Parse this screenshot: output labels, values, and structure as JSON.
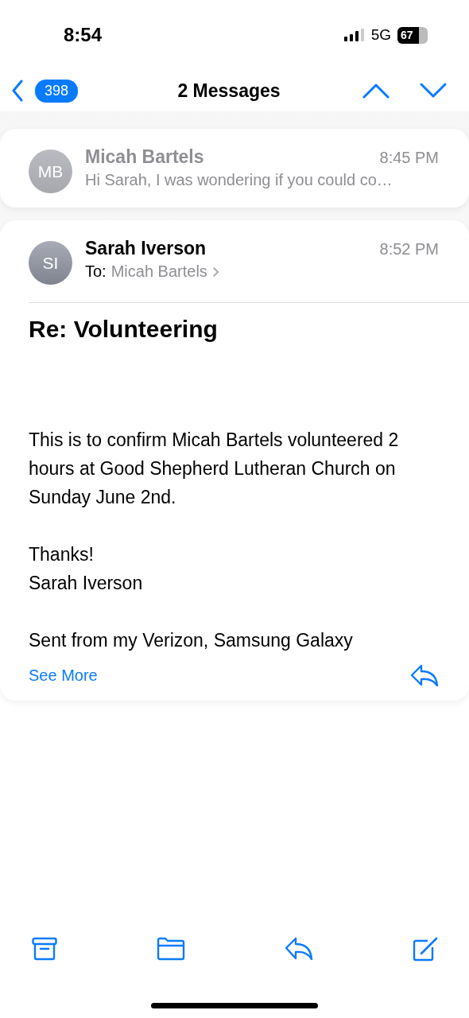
{
  "status_bar": {
    "time": "8:54",
    "network": "5G",
    "battery": "67"
  },
  "nav": {
    "back_count": "398",
    "title": "2 Messages"
  },
  "messages": [
    {
      "initials": "MB",
      "sender": "Micah Bartels",
      "time": "8:45 PM",
      "expanded": false,
      "preview": "Hi Sarah, I was wondering if you could co…"
    },
    {
      "initials": "SI",
      "sender": "Sarah Iverson",
      "time": "8:52 PM",
      "expanded": true,
      "to_label": "To:",
      "to": "Micah Bartels",
      "subject": "Re: Volunteering",
      "body": [
        "This is to confirm Micah Bartels volunteered 2 hours at Good Shepherd Lutheran Church on Sunday June 2nd.",
        "Thanks!\nSarah Iverson",
        "Sent from my Verizon, Samsung Galaxy"
      ],
      "see_more": "See More"
    }
  ]
}
